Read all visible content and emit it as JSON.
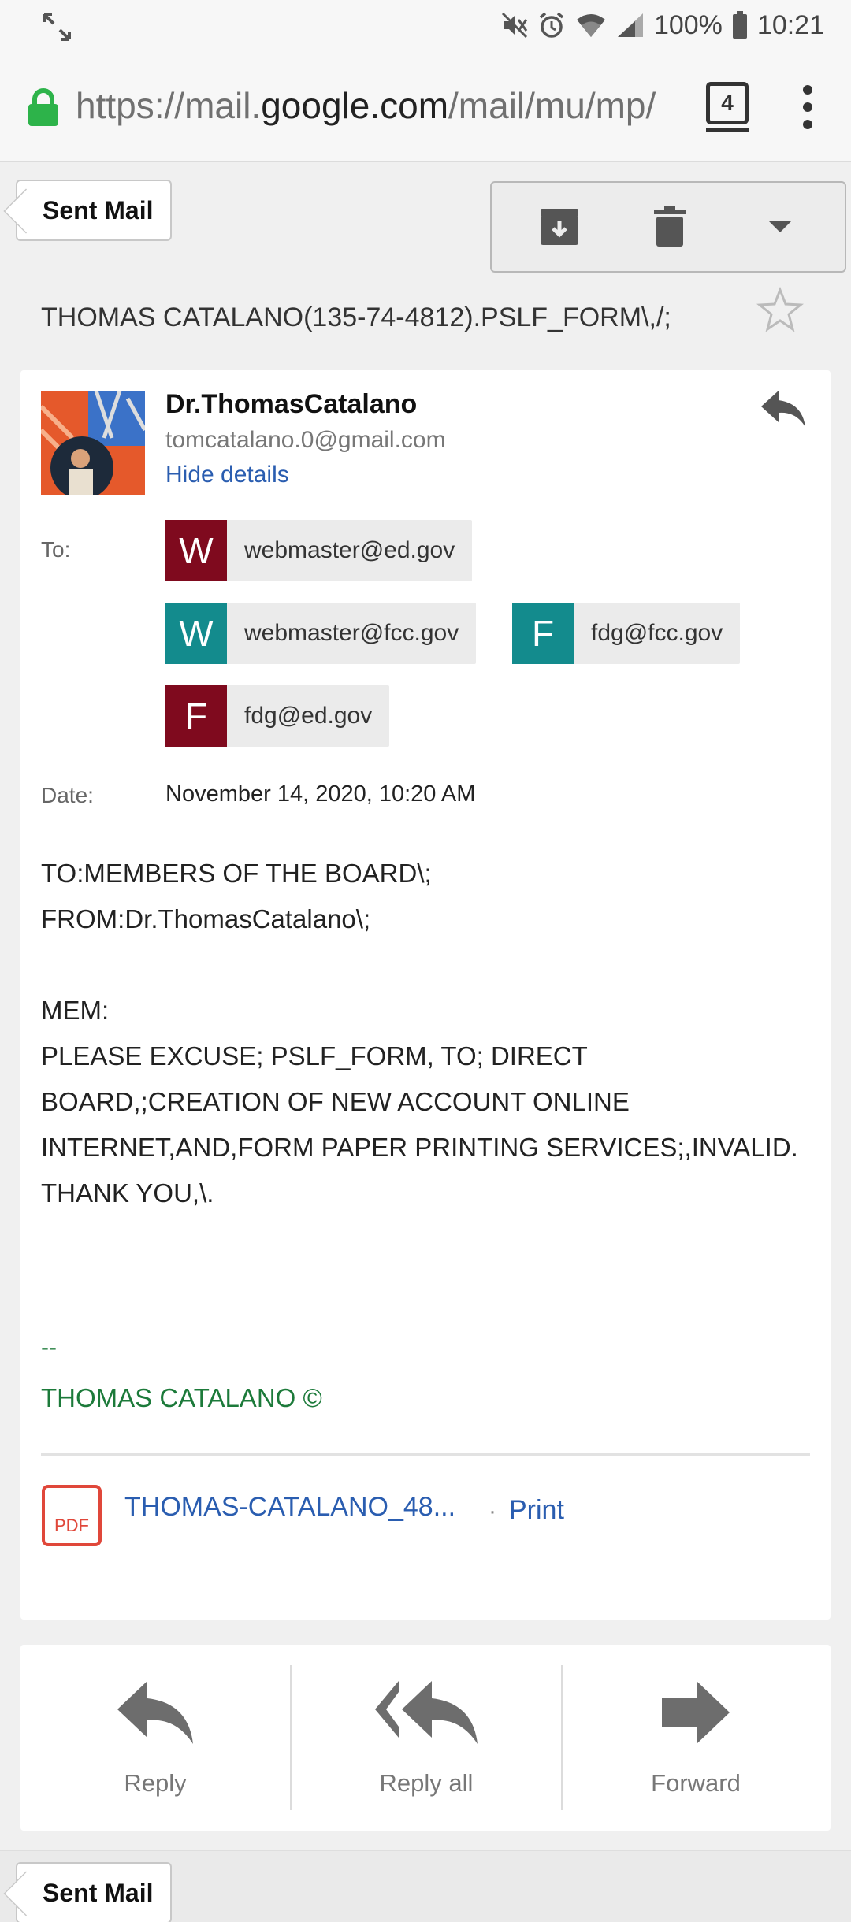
{
  "status_bar": {
    "battery": "100%",
    "time": "10:21"
  },
  "url_bar": {
    "url_prefix": "https://mail.",
    "url_host": "google.com",
    "url_path": "/mail/mu/mp/",
    "tab_count": "4"
  },
  "nav": {
    "back_label": "Sent Mail"
  },
  "toolbar": {
    "archive_icon": "archive-icon",
    "delete_icon": "trash-icon",
    "more_icon": "caret-down-icon"
  },
  "message": {
    "subject": "THOMAS CATALANO(135-74-4812).PSLF_FORM\\,/;",
    "sender_name": "Dr.ThomasCatalano",
    "sender_email": "tomcatalano.0@gmail.com",
    "hide_details": "Hide details",
    "to_label": "To:",
    "recipients": [
      {
        "letter": "W",
        "address": "webmaster@ed.gov",
        "color": "#7f0a1e"
      },
      {
        "letter": "W",
        "address": "webmaster@fcc.gov",
        "color": "#138b8d"
      },
      {
        "letter": "F",
        "address": "fdg@fcc.gov",
        "color": "#138b8d"
      },
      {
        "letter": "F",
        "address": "fdg@ed.gov",
        "color": "#7f0a1e"
      }
    ],
    "date_label": "Date:",
    "date_value": "November 14, 2020, 10:20 AM",
    "body": [
      "TO:MEMBERS OF THE BOARD\\;",
      "FROM:Dr.ThomasCatalano\\;",
      "",
      "MEM:",
      "PLEASE EXCUSE; PSLF_FORM, TO; DIRECT",
      "BOARD,;CREATION OF NEW ACCOUNT ONLINE",
      "INTERNET,AND,FORM PAPER PRINTING SERVICES;,INVALID.",
      "THANK YOU,\\."
    ],
    "signature_dash": "--",
    "signature_name": "THOMAS CATALANO ©",
    "attachment": {
      "name": "THOMAS-CATALANO_48...",
      "separator": "·",
      "print_label": "Print",
      "icon_text": "PDF"
    }
  },
  "reply_bar": {
    "reply": "Reply",
    "reply_all": "Reply all",
    "forward": "Forward"
  },
  "colors": {
    "link": "#2a5db0",
    "signature": "#1c7a3a",
    "lock": "#2db34a",
    "pdf": "#e0473a"
  }
}
